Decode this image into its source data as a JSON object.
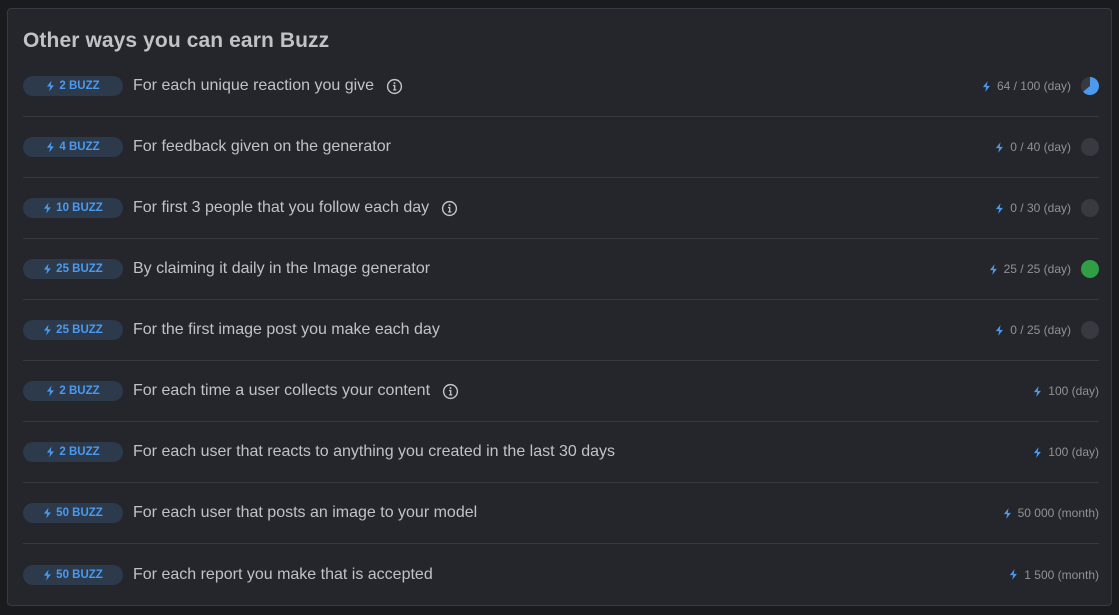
{
  "header": {
    "title": "Other ways you can earn Buzz"
  },
  "colors": {
    "accent": "#4a9af0",
    "complete": "#2f9e44",
    "empty": "#373a40"
  },
  "rows": [
    {
      "badge": "2 BUZZ",
      "description": "For each unique reaction you give",
      "info": true,
      "progress": "64 / 100 (day)",
      "ratio": 0.64,
      "indicator": true
    },
    {
      "badge": "4 BUZZ",
      "description": "For feedback given on the generator",
      "info": false,
      "progress": "0 / 40 (day)",
      "ratio": 0,
      "indicator": true
    },
    {
      "badge": "10 BUZZ",
      "description": "For first 3 people that you follow each day",
      "info": true,
      "progress": "0 / 30 (day)",
      "ratio": 0,
      "indicator": true
    },
    {
      "badge": "25 BUZZ",
      "description": "By claiming it daily in the Image generator",
      "info": false,
      "progress": "25 / 25 (day)",
      "ratio": 1,
      "indicator": true
    },
    {
      "badge": "25 BUZZ",
      "description": "For the first image post you make each day",
      "info": false,
      "progress": "0 / 25 (day)",
      "ratio": 0,
      "indicator": true
    },
    {
      "badge": "2 BUZZ",
      "description": "For each time a user collects your content",
      "info": true,
      "progress": "100 (day)",
      "indicator": false
    },
    {
      "badge": "2 BUZZ",
      "description": "For each user that reacts to anything you created in the last 30 days",
      "info": false,
      "progress": "100 (day)",
      "indicator": false
    },
    {
      "badge": "50 BUZZ",
      "description": "For each user that posts an image to your model",
      "info": false,
      "progress": "50 000 (month)",
      "indicator": false
    },
    {
      "badge": "50 BUZZ",
      "description": "For each report you make that is accepted",
      "info": false,
      "progress": "1 500 (month)",
      "indicator": false
    }
  ]
}
